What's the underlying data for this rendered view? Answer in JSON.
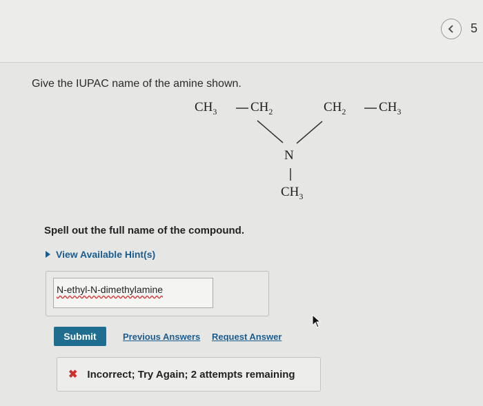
{
  "header": {
    "nav_icon": "chevron-left-icon",
    "page_number": "5"
  },
  "question": {
    "prompt": "Give the IUPAC name of the amine shown.",
    "structure": {
      "left_chain_ch3": "CH",
      "left_chain_ch3_sub": "3",
      "left_chain_ch2": "CH",
      "left_chain_ch2_sub": "2",
      "right_chain_ch2": "CH",
      "right_chain_ch2_sub": "2",
      "right_chain_ch3": "CH",
      "right_chain_ch3_sub": "3",
      "nitrogen": "N",
      "bottom_ch3": "CH",
      "bottom_ch3_sub": "3"
    }
  },
  "part": {
    "instruction": "Spell out the full name of the compound.",
    "hint_label": "View Available Hint(s)",
    "answer_value": "N-ethyl-N-dimethylamine",
    "submit_label": "Submit",
    "previous_answers_label": "Previous Answers",
    "request_answer_label": "Request Answer",
    "feedback_text": "Incorrect; Try Again; 2 attempts remaining",
    "colors": {
      "link": "#1b5c8f",
      "submit_bg": "#1f6e8f",
      "error": "#c8322f"
    }
  }
}
